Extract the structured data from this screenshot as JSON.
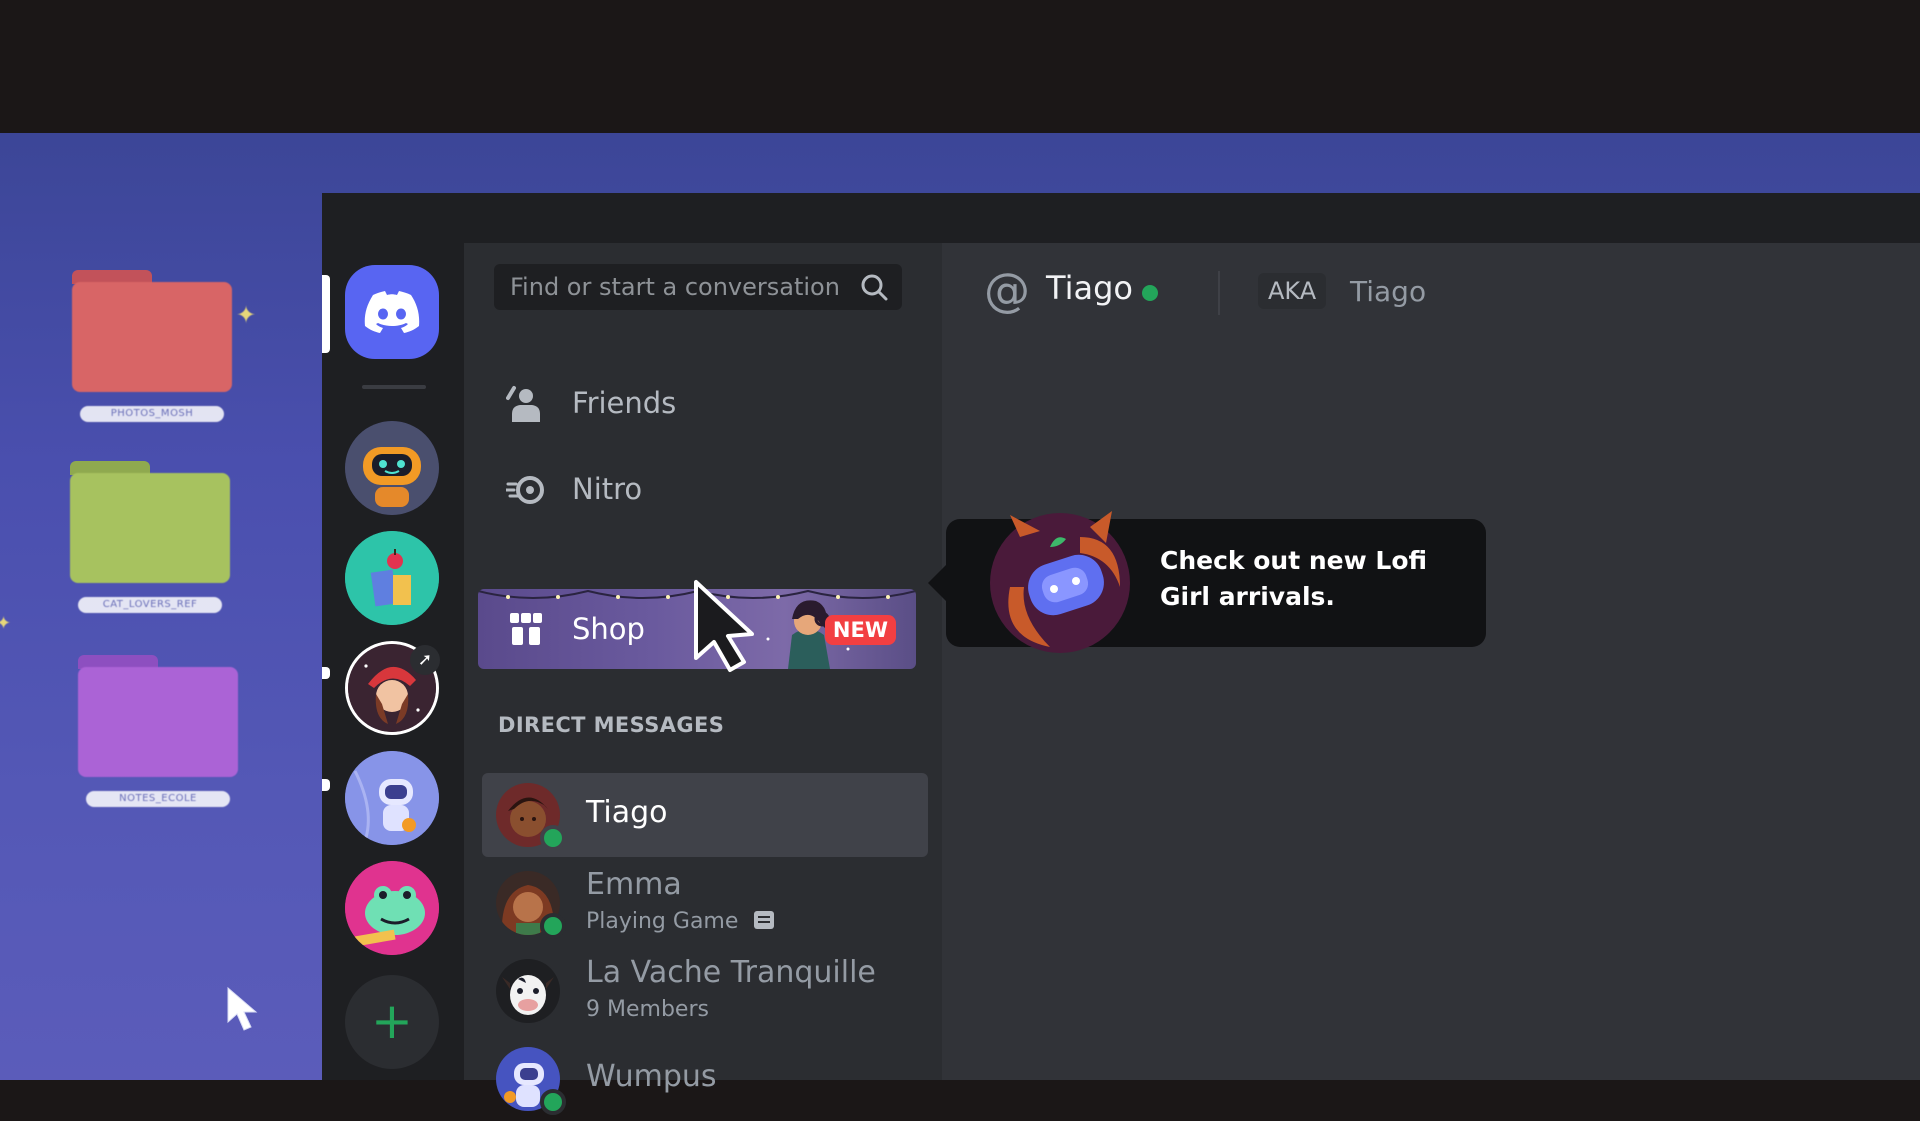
{
  "desktop": {
    "folders": [
      {
        "label": "PHOTOS_MOSH",
        "color": "#d86566"
      },
      {
        "label": "CAT_LOVERS_REF",
        "color": "#a7c25f"
      },
      {
        "label": "NOTES_ECOLE",
        "color": "#ab63d6"
      }
    ]
  },
  "search": {
    "placeholder": "Find or start a conversation"
  },
  "nav": {
    "friends": "Friends",
    "nitro": "Nitro",
    "shop": "Shop",
    "shop_badge": "NEW"
  },
  "dms": {
    "header": "DIRECT MESSAGES",
    "items": [
      {
        "name": "Tiago",
        "sub": ""
      },
      {
        "name": "Emma",
        "sub": "Playing Game"
      },
      {
        "name": "La Vache Tranquille",
        "sub": "9 Members"
      },
      {
        "name": "Wumpus",
        "sub": ""
      }
    ]
  },
  "header": {
    "channel": "Tiago",
    "aka_label": "AKA",
    "aka_name": "Tiago"
  },
  "tooltip": {
    "message": "Check out new Lofi Girl arrivals."
  },
  "colors": {
    "blurple": "#5865f2",
    "online": "#23a55a",
    "badge": "#f23f42"
  },
  "add_server": "+"
}
